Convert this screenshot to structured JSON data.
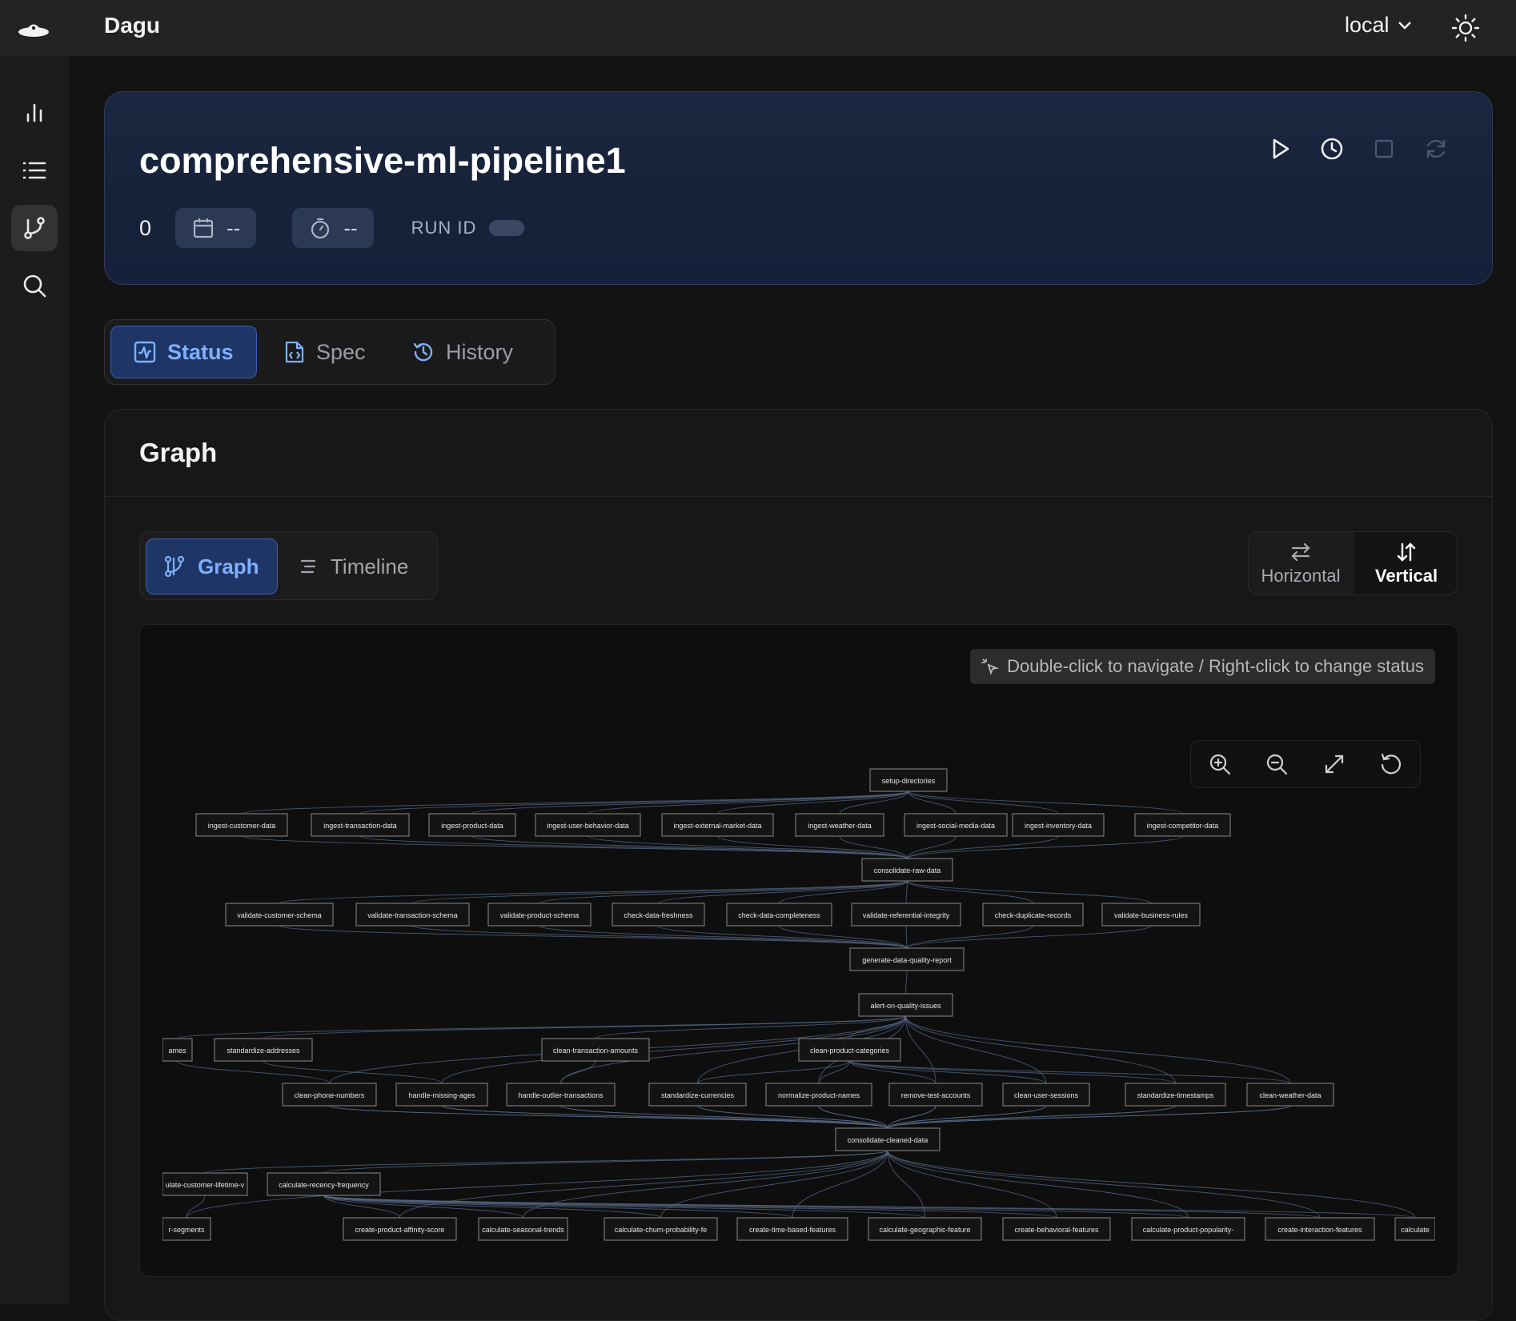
{
  "app": {
    "title": "Dagu",
    "environment": "local"
  },
  "dag": {
    "name": "comprehensive-ml-pipeline1",
    "run_count": "0",
    "date": "--",
    "duration": "--",
    "run_id_label": "RUN ID"
  },
  "tabs": [
    {
      "label": "Status",
      "icon": "status-icon",
      "active": true
    },
    {
      "label": "Spec",
      "icon": "spec-icon",
      "active": false
    },
    {
      "label": "History",
      "icon": "history-icon",
      "active": false
    }
  ],
  "card": {
    "title": "Graph",
    "view_tabs": [
      {
        "label": "Graph",
        "active": true
      },
      {
        "label": "Timeline",
        "active": false
      }
    ],
    "orientation": [
      {
        "label": "Horizontal",
        "active": false
      },
      {
        "label": "Vertical",
        "active": true
      }
    ],
    "hint": "Double-click to navigate / Right-click to change status"
  },
  "colors": {
    "accent": "#7fb0ff",
    "hero_bg": "#17223a",
    "node_bg": "#141414",
    "edge": "#5a6a8a"
  },
  "graph": {
    "rows": [
      [
        "setup-directories"
      ],
      [
        "ingest-customer-data",
        "ingest-transaction-data",
        "ingest-product-data",
        "ingest-user-behavior-data",
        "ingest-external-market-data",
        "ingest-weather-data",
        "ingest-social-media-data",
        "ingest-inventory-data",
        "ingest-competitor-data"
      ],
      [
        "consolidate-raw-data"
      ],
      [
        "validate-customer-schema",
        "validate-transaction-schema",
        "validate-product-schema",
        "check-data-freshness",
        "check-data-completeness",
        "validate-referential-integrity",
        "check-duplicate-records",
        "validate-business-rules"
      ],
      [
        "generate-data-quality-report"
      ],
      [
        "alert-on-quality-issues"
      ],
      [
        "ames",
        "standardize-addresses",
        "clean-transaction-amounts",
        "clean-product-categories"
      ],
      [
        "clean-phone-numbers",
        "handle-missing-ages",
        "handle-outlier-transactions",
        "standardize-currencies",
        "normalize-product-names",
        "remove-test-accounts",
        "clean-user-sessions",
        "standardize-timestamps",
        "clean-weather-data"
      ],
      [
        "consolidate-cleaned-data"
      ],
      [
        "ulate-customer-lifetime-v",
        "calculate-recency-frequency"
      ],
      [
        "r-segments",
        "create-product-affinity-score",
        "calculate-seasonal-trends",
        "calculate-churn-probability-fe",
        "create-time-based-features",
        "calculate-geographic-feature",
        "create-behavioral-features",
        "calculate-product-popularity-",
        "create-interaction-features",
        "calculate"
      ]
    ]
  }
}
